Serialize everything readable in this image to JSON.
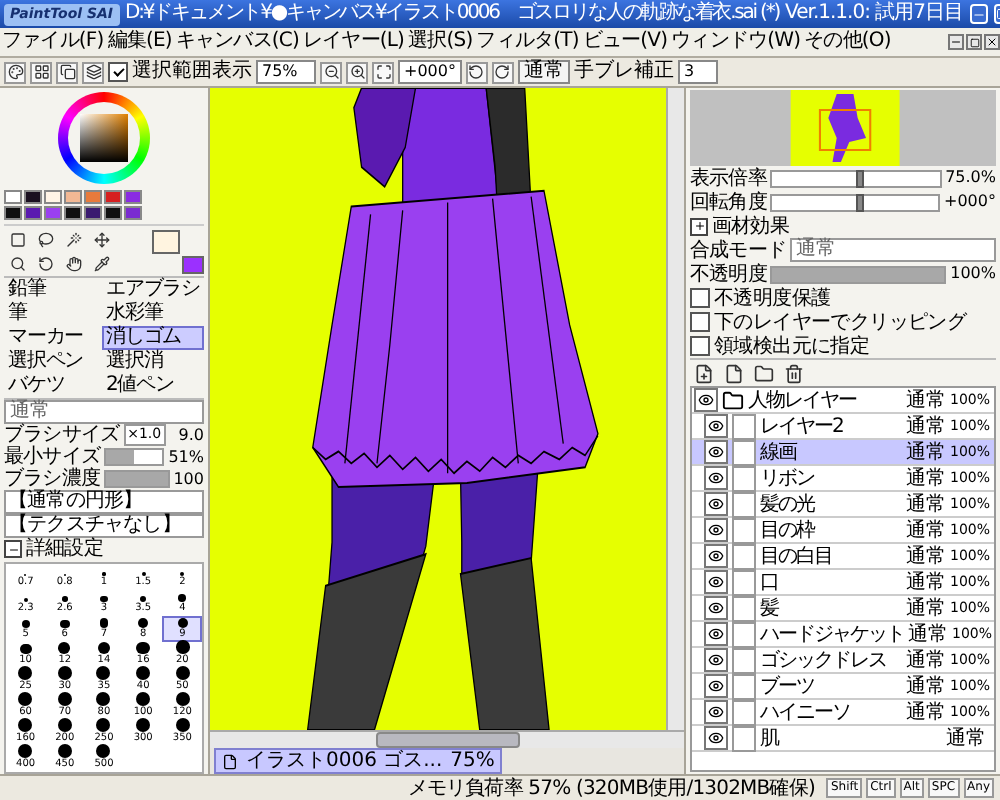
{
  "title_bar": {
    "logo": "PaintTool SAI",
    "title": "D:¥ドキュメント¥●キャンバス¥イラスト0006　ゴスロリな人の軌跡な着衣.sai (*)",
    "version": "Ver.1.1.0: 試用7日目"
  },
  "menu": [
    "ファイル(F)",
    "編集(E)",
    "キャンバス(C)",
    "レイヤー(L)",
    "選択(S)",
    "フィルタ(T)",
    "ビュー(V)",
    "ウィンドウ(W)",
    "その他(O)"
  ],
  "toolbar": {
    "selection_visible": {
      "label": "選択範囲表示",
      "checked": true
    },
    "zoom": "75%",
    "angle": "+000°",
    "mode": "通常",
    "stabilizer_label": "手ブレ補正",
    "stabilizer": "3"
  },
  "swatches": [
    {
      "color": "#ffffff"
    },
    {
      "color": "#1a1020"
    },
    {
      "color": "#fff4e6"
    },
    {
      "color": "#f2b894"
    },
    {
      "color": "#e87a3c"
    },
    {
      "color": "#d62020"
    },
    {
      "color": "#8a2be2"
    },
    {
      "color": "#101010"
    },
    {
      "color": "#5a1ab0"
    },
    {
      "color": "#9a40f0"
    },
    {
      "color": "#101010"
    },
    {
      "color": "#3a1a70"
    },
    {
      "color": "#101010"
    },
    {
      "color": "#7a2bd0"
    }
  ],
  "current_colors": [
    {
      "color": "#fff4e0"
    },
    {
      "color": "#9b30ff"
    }
  ],
  "tools": [
    {
      "label": "鉛筆",
      "selected": false
    },
    {
      "label": "エアブラシ",
      "selected": false
    },
    {
      "label": "筆",
      "selected": false
    },
    {
      "label": "水彩筆",
      "selected": false
    },
    {
      "label": "マーカー",
      "selected": false
    },
    {
      "label": "消しゴム",
      "selected": true
    },
    {
      "label": "選択ペン",
      "selected": false
    },
    {
      "label": "選択消",
      "selected": false
    },
    {
      "label": "バケツ",
      "selected": false
    },
    {
      "label": "2値ペン",
      "selected": false
    }
  ],
  "blend_mode": "通常",
  "sliders": [
    {
      "label": "ブラシサイズ",
      "multiplier": "×1.0",
      "value": "9.0"
    },
    {
      "label": "最小サイズ",
      "value": "51%",
      "level": 0.51
    },
    {
      "label": "ブラシ濃度",
      "value": "100",
      "level": 1
    }
  ],
  "brush_shape": "【通常の円形】",
  "texture": "【テクスチャなし】",
  "details": {
    "label": "詳細設定",
    "expanded": true
  },
  "brush_sizes": [
    {
      "label": "0.7",
      "selected": false
    },
    {
      "label": "0.8",
      "selected": false
    },
    {
      "label": "1",
      "selected": false
    },
    {
      "label": "1.5",
      "selected": false
    },
    {
      "label": "2",
      "selected": false
    },
    {
      "label": "2.3",
      "selected": false
    },
    {
      "label": "2.6",
      "selected": false
    },
    {
      "label": "3",
      "selected": false
    },
    {
      "label": "3.5",
      "selected": false
    },
    {
      "label": "4",
      "selected": false
    },
    {
      "label": "5",
      "selected": false
    },
    {
      "label": "6",
      "selected": false
    },
    {
      "label": "7",
      "selected": false
    },
    {
      "label": "8",
      "selected": false
    },
    {
      "label": "9",
      "selected": true
    },
    {
      "label": "10",
      "selected": false
    },
    {
      "label": "12",
      "selected": false
    },
    {
      "label": "14",
      "selected": false
    },
    {
      "label": "16",
      "selected": false
    },
    {
      "label": "20",
      "selected": false
    },
    {
      "label": "25",
      "selected": false
    },
    {
      "label": "30",
      "selected": false
    },
    {
      "label": "35",
      "selected": false
    },
    {
      "label": "40",
      "selected": false
    },
    {
      "label": "50",
      "selected": false
    },
    {
      "label": "60",
      "selected": false
    },
    {
      "label": "70",
      "selected": false
    },
    {
      "label": "80",
      "selected": false
    },
    {
      "label": "100",
      "selected": false
    },
    {
      "label": "120",
      "selected": false
    },
    {
      "label": "160",
      "selected": false
    },
    {
      "label": "200",
      "selected": false
    },
    {
      "label": "250",
      "selected": false
    },
    {
      "label": "300",
      "selected": false
    },
    {
      "label": "350",
      "selected": false
    },
    {
      "label": "400",
      "selected": false
    },
    {
      "label": "450",
      "selected": false
    },
    {
      "label": "500",
      "selected": false
    }
  ],
  "canvas_tab": {
    "label": "イラスト0006 ゴス...",
    "zoom": "75%"
  },
  "navigator": {
    "zoom": {
      "label": "表示倍率",
      "value": "75.0%",
      "level": 0.5
    },
    "angle": {
      "label": "回転角度",
      "value": "+000°",
      "level": 0.5
    }
  },
  "layer_options": {
    "effects": {
      "label": "画材効果",
      "expanded": false
    },
    "mode_label": "合成モード",
    "mode": "通常",
    "opacity": {
      "label": "不透明度",
      "value": "100%",
      "level": 1
    },
    "checks": [
      {
        "label": "不透明度保護",
        "checked": false
      },
      {
        "label": "下のレイヤーでクリッピング",
        "checked": false
      },
      {
        "label": "領域検出元に指定",
        "checked": false
      }
    ]
  },
  "layers": [
    {
      "name": "人物レイヤー",
      "kind": "folder",
      "mode": "通常",
      "opacity": "100%",
      "visible": true,
      "selected": false,
      "children": [
        {
          "name": "レイヤー2",
          "kind": "layer",
          "mode": "通常",
          "opacity": "100%",
          "visible": true,
          "selected": false
        },
        {
          "name": "線画",
          "kind": "layer",
          "mode": "通常",
          "opacity": "100%",
          "visible": true,
          "selected": true
        },
        {
          "name": "リボン",
          "kind": "layer",
          "mode": "通常",
          "opacity": "100%",
          "visible": true,
          "selected": false
        },
        {
          "name": "髪の光",
          "kind": "layer",
          "mode": "通常",
          "opacity": "100%",
          "visible": true,
          "selected": false
        },
        {
          "name": "目の枠",
          "kind": "layer",
          "mode": "通常",
          "opacity": "100%",
          "visible": true,
          "selected": false
        },
        {
          "name": "目の白目",
          "kind": "layer",
          "mode": "通常",
          "opacity": "100%",
          "visible": true,
          "selected": false
        },
        {
          "name": "口",
          "kind": "layer",
          "mode": "通常",
          "opacity": "100%",
          "visible": true,
          "selected": false
        },
        {
          "name": "髪",
          "kind": "layer",
          "mode": "通常",
          "opacity": "100%",
          "visible": true,
          "selected": false
        },
        {
          "name": "ハードジャケット",
          "kind": "layer",
          "mode": "通常",
          "opacity": "100%",
          "visible": true,
          "selected": false
        },
        {
          "name": "ゴシックドレス",
          "kind": "layer",
          "mode": "通常",
          "opacity": "100%",
          "visible": true,
          "selected": false
        },
        {
          "name": "ブーツ",
          "kind": "layer",
          "mode": "通常",
          "opacity": "100%",
          "visible": true,
          "selected": false
        },
        {
          "name": "ハイニーソ",
          "kind": "layer",
          "mode": "通常",
          "opacity": "100%",
          "visible": true,
          "selected": false
        },
        {
          "name": "肌",
          "kind": "layer",
          "mode": "通常",
          "visible": true,
          "selected": false
        }
      ]
    }
  ],
  "status": {
    "memory": "メモリ負荷率 57% (320MB使用/1302MB確保)",
    "keys": [
      "Shift",
      "Ctrl",
      "Alt",
      "SPC",
      "Any"
    ]
  }
}
